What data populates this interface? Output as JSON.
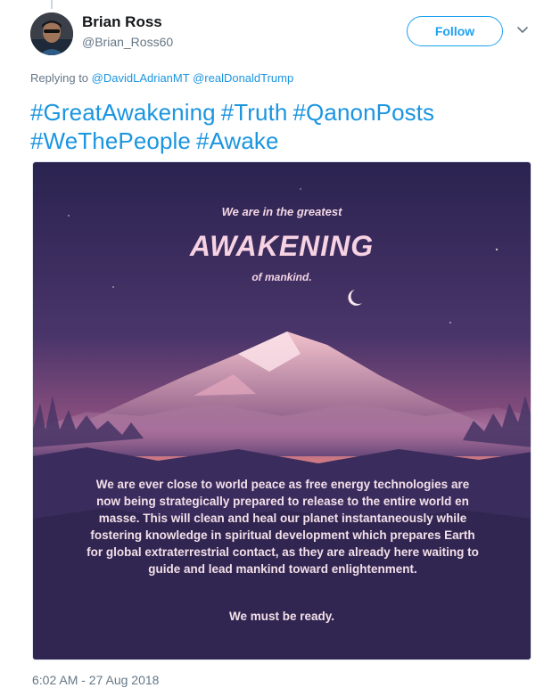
{
  "author": {
    "display_name": "Brian Ross",
    "handle": "@Brian_Ross60"
  },
  "actions": {
    "follow_label": "Follow",
    "menu_icon": "chevron-down-icon"
  },
  "reply": {
    "prefix": "Replying to",
    "mentions": [
      "@DavidLAdrianMT",
      "@realDonaldTrump"
    ]
  },
  "tweet": {
    "hashtags": [
      "#GreatAwakening",
      "#Truth",
      "#QanonPosts",
      "#WeThePeople",
      "#Awake"
    ]
  },
  "image": {
    "line1": "We are in the greatest",
    "headline": "AWAKENING",
    "line3": "of mankind.",
    "body": "We are ever close to world peace as free energy technologies are now being strategically prepared to release to the entire world en masse. This will clean and heal our planet instantaneously while fostering knowledge in spiritual development which prepares Earth for global extraterrestrial contact, as they are already here waiting to guide and lead mankind toward enlightenment.",
    "closing": "We must be ready.",
    "colors": {
      "sky_top": "#2a2350",
      "sky_mid": "#7a4a7a",
      "horizon": "#d07a84",
      "ground": "#2c2348"
    }
  },
  "meta": {
    "timestamp": "6:02 AM - 27 Aug 2018"
  },
  "colors": {
    "accent": "#1da1f2",
    "link": "#1b95e0",
    "muted": "#657786"
  }
}
